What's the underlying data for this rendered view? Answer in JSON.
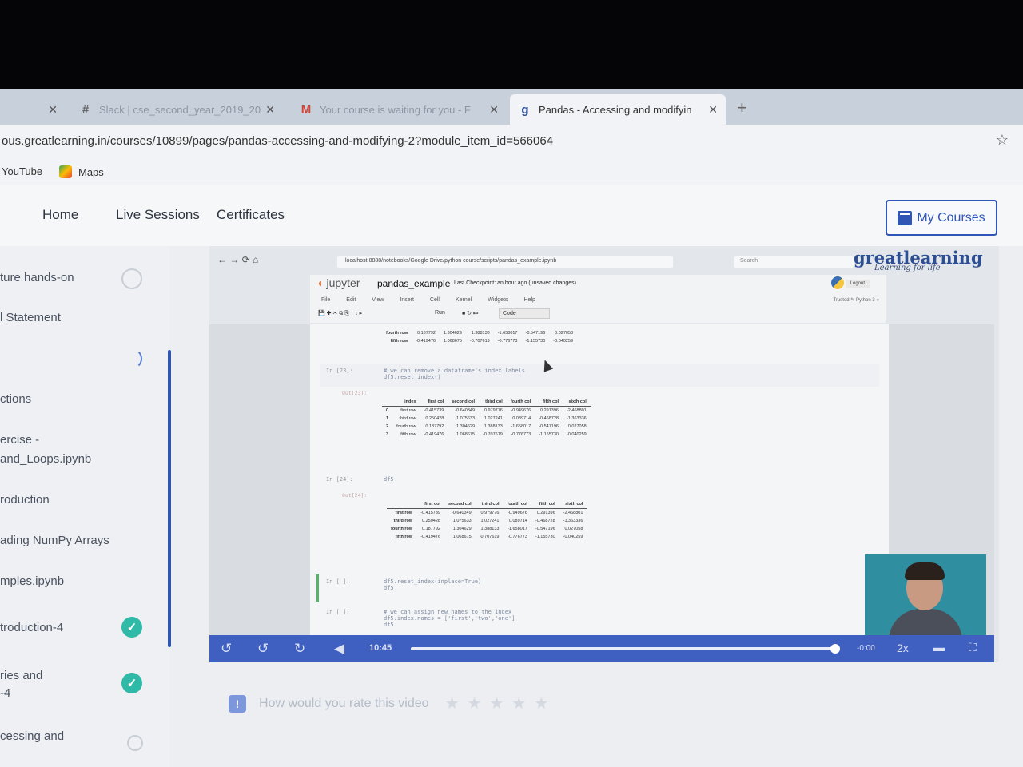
{
  "browser": {
    "tabs": [
      {
        "label": "",
        "icon": "blank-icon"
      },
      {
        "label": "Slack | cse_second_year_2019_20",
        "icon": "slack-icon"
      },
      {
        "label": "Your course is waiting for you - F",
        "icon": "gmail-icon"
      },
      {
        "label": "Pandas - Accessing and modifyin",
        "icon": "greatlearning-icon",
        "active": true
      }
    ],
    "url": "ous.greatlearning.in/courses/10899/pages/pandas-accessing-and-modifying-2?module_item_id=566064",
    "bookmarks": [
      "YouTube",
      "Maps"
    ]
  },
  "nav": {
    "home": "Home",
    "live": "Live Sessions",
    "certs": "Certificates",
    "my_courses": "My Courses"
  },
  "sidebar": {
    "items": [
      {
        "label": "ture hands-on",
        "status": "empty"
      },
      {
        "label": "l Statement",
        "status": "none"
      },
      {
        "label": "",
        "status": "loading"
      },
      {
        "label": "ctions",
        "status": "none"
      },
      {
        "label": "ercise -",
        "status": "none"
      },
      {
        "label": "and_Loops.ipynb",
        "status": "none"
      },
      {
        "label": "roduction",
        "status": "none"
      },
      {
        "label": "ading NumPy Arrays",
        "status": "none"
      },
      {
        "label": "mples.ipynb",
        "status": "none"
      },
      {
        "label": "troduction-4",
        "status": "done"
      },
      {
        "label": "ries and",
        "status": "done"
      },
      {
        "label": "-4",
        "status": "none"
      },
      {
        "label": "cessing and",
        "status": "empty"
      }
    ]
  },
  "firefox": {
    "url": "localhost:8888/notebooks/Google Drive/python course/scripts/pandas_example.ipynb",
    "search": "Search"
  },
  "branding": {
    "logo": "greatlearning",
    "tagline": "Learning for life"
  },
  "jupyter": {
    "logo": "jupyter",
    "notebook": "pandas_example",
    "checkpoint": "Last Checkpoint: an hour ago  (unsaved changes)",
    "logout": "Logout",
    "trusted": "Trusted",
    "kernel": "Python 3",
    "menu": [
      "File",
      "Edit",
      "View",
      "Insert",
      "Cell",
      "Kernel",
      "Widgets",
      "Help"
    ],
    "toolbar_run": "Run",
    "cell_type": "Code"
  },
  "notebook": {
    "top_rows": [
      [
        "fourth row",
        "0.187792",
        "1.304629",
        "1.388133",
        "-1.658017",
        "-0.547196",
        "0.027058"
      ],
      [
        "fifth row",
        "-0.419476",
        "1.068675",
        "-0.707619",
        "-0.776773",
        "-1.155730",
        "-0.040259"
      ]
    ],
    "cell23_in": "In [23]:",
    "cell23_code": "# we can remove a dataframe's index labels\ndf5.reset_index()",
    "cell23_out": "Out[23]:",
    "reset_headers": [
      "",
      "index",
      "first col",
      "second col",
      "third col",
      "fourth col",
      "fifth col",
      "sixth col"
    ],
    "reset_rows": [
      [
        "0",
        "first row",
        "-0.415739",
        "-0.640349",
        "0.979776",
        "-0.949676",
        "0.291396",
        "-2.468801"
      ],
      [
        "1",
        "third row",
        "0.250428",
        "1.075633",
        "1.027241",
        "0.089714",
        "-0.468728",
        "-1.363336"
      ],
      [
        "2",
        "fourth row",
        "0.187792",
        "1.304629",
        "1.388133",
        "-1.658017",
        "-0.547196",
        "0.027058"
      ],
      [
        "3",
        "fifth row",
        "-0.419476",
        "1.068675",
        "-0.707619",
        "-0.776773",
        "-1.155730",
        "-0.040259"
      ]
    ],
    "cell24_in": "In [24]:",
    "cell24_code": "df5",
    "cell24_out": "Out[24]:",
    "df_headers": [
      "",
      "first col",
      "second col",
      "third col",
      "fourth col",
      "fifth col",
      "sixth col"
    ],
    "df_rows": [
      [
        "first row",
        "-0.415739",
        "-0.640349",
        "0.979776",
        "-0.949676",
        "0.291396",
        "-2.468801"
      ],
      [
        "third row",
        "0.250428",
        "1.075633",
        "1.027241",
        "0.089714",
        "-0.468728",
        "-1.363336"
      ],
      [
        "fourth row",
        "0.187792",
        "1.304629",
        "1.388133",
        "-1.658017",
        "-0.547196",
        "0.027058"
      ],
      [
        "fifth row",
        "-0.419476",
        "1.068675",
        "-0.707619",
        "-0.776773",
        "-1.155730",
        "-0.040259"
      ]
    ],
    "cell25_in": "In [ ]:",
    "cell25_code": "df5.reset_index(inplace=True)\ndf5",
    "cell26_in": "In [ ]:",
    "cell26_code": "# we can assign new names to the index\ndf5.index.names = ['first','two','one']\ndf5"
  },
  "video": {
    "current_time": "10:45",
    "remaining": "-0:00",
    "speed": "2x",
    "progress": 0.99
  },
  "rating": {
    "prompt": "How would you rate this video",
    "stars": 5
  },
  "colors": {
    "accent": "#2f56b5",
    "complete": "#2fb9a7",
    "video_bar": "#3f5fc1"
  }
}
